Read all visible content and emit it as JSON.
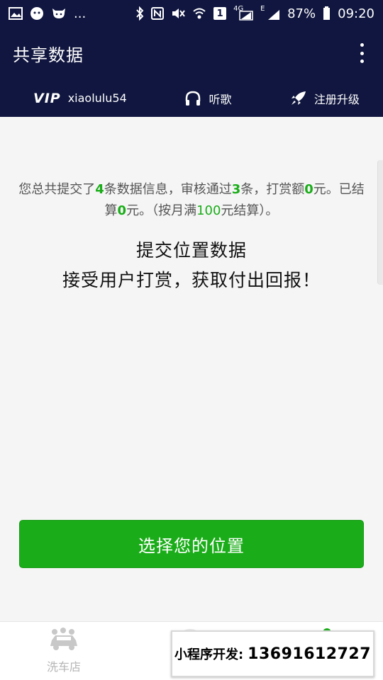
{
  "status_bar": {
    "dots": "...",
    "sim_label": "1",
    "network_type": "4G",
    "network_e": "E",
    "battery": "87%",
    "time": "09:20"
  },
  "app_bar": {
    "title": "共享数据"
  },
  "toolbar": {
    "vip_label": "VIP",
    "username": "xiaolulu54",
    "music_label": "听歌",
    "upgrade_label": "注册升级"
  },
  "summary": {
    "prefix": "您总共提交了",
    "submitted": "4",
    "mid1": "条数据信息，审核通过",
    "approved": "3",
    "mid2": "条，打赏额",
    "reward": "0",
    "mid3": "元。已结算",
    "settled": "0",
    "mid4": "元。（按月满",
    "threshold": "100",
    "suffix": "元结算）。"
  },
  "headline": {
    "line1": "提交位置数据",
    "line2": "接受用户打赏，获取付出回报！"
  },
  "choose_button": "选择您的位置",
  "bottom_bar": {
    "tab_carwash": "洗车店"
  },
  "promo": {
    "label": "小程序开发:",
    "phone": "13691612727"
  },
  "colors": {
    "header_bg": "#10163f",
    "accent_green": "#1aad19",
    "content_bg": "#f5f5f5"
  }
}
